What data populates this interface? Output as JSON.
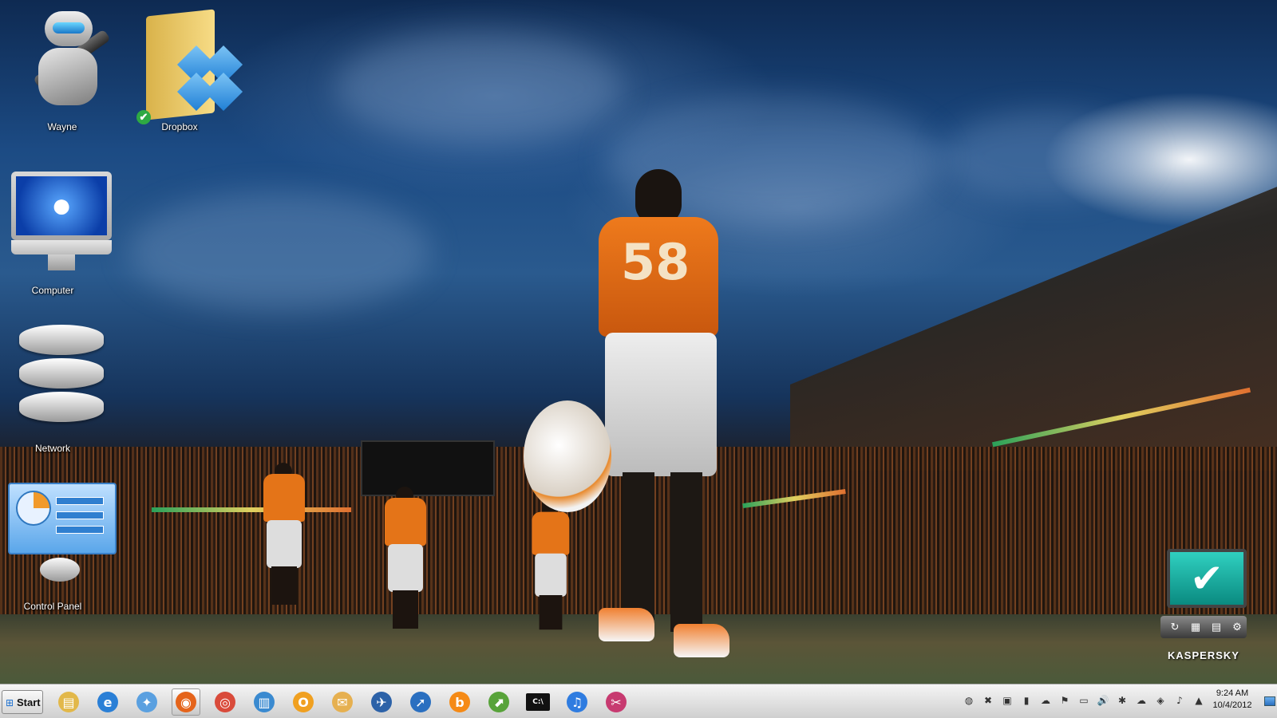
{
  "desktop": {
    "icons": [
      {
        "label": "Wayne",
        "icon": "automator-robot-icon"
      },
      {
        "label": "Dropbox",
        "icon": "dropbox-folder-icon"
      },
      {
        "label": "Computer",
        "icon": "imac-computer-icon"
      },
      {
        "label": "Network",
        "icon": "network-disks-icon"
      },
      {
        "label": "Control Panel",
        "icon": "control-panel-icon"
      }
    ],
    "wallpaper": {
      "jersey_number": "58"
    }
  },
  "kaspersky_gadget": {
    "brand": "KASPERSKY",
    "status_glyph": "✔",
    "buttons": [
      "refresh-icon",
      "calendar-icon",
      "report-icon",
      "settings-icon"
    ]
  },
  "taskbar": {
    "start_label": "Start",
    "pinned": [
      {
        "name": "windows-explorer-icon",
        "glyph": "▤",
        "color": "#e2b84a"
      },
      {
        "name": "internet-explorer-icon",
        "glyph": "e",
        "color": "#2a7fd6"
      },
      {
        "name": "safari-icon",
        "glyph": "✦",
        "color": "#5aa0e0"
      },
      {
        "name": "firefox-icon",
        "glyph": "◉",
        "color": "#e5641b",
        "active": true
      },
      {
        "name": "chrome-icon",
        "glyph": "◎",
        "color": "#d94b3b"
      },
      {
        "name": "notepad-icon",
        "glyph": "▥",
        "color": "#3a8ad0"
      },
      {
        "name": "outlook-icon",
        "glyph": "O",
        "color": "#f0a020"
      },
      {
        "name": "mail-icon",
        "glyph": "✉",
        "color": "#e6b050"
      },
      {
        "name": "thunderbird-icon",
        "glyph": "✈",
        "color": "#2c62a8"
      },
      {
        "name": "rocket-app-icon",
        "glyph": "➚",
        "color": "#2a6fc0"
      },
      {
        "name": "blogger-icon",
        "glyph": "b",
        "color": "#f58a16"
      },
      {
        "name": "stock-chart-icon",
        "glyph": "⬈",
        "color": "#58a33a"
      },
      {
        "name": "command-prompt-icon",
        "glyph": "C:\\",
        "color": "#111111"
      },
      {
        "name": "itunes-icon",
        "glyph": "♫",
        "color": "#2f7ce0"
      },
      {
        "name": "snipping-tool-icon",
        "glyph": "✂",
        "color": "#c73a70"
      }
    ],
    "tray": [
      {
        "name": "network-globe-icon",
        "glyph": "◍"
      },
      {
        "name": "pdf-icon",
        "glyph": "✖"
      },
      {
        "name": "app-window-icon",
        "glyph": "▣"
      },
      {
        "name": "battery-icon",
        "glyph": "▮"
      },
      {
        "name": "cloud-sync-icon",
        "glyph": "☁"
      },
      {
        "name": "action-center-flag-icon",
        "glyph": "⚑"
      },
      {
        "name": "display-icon",
        "glyph": "▭"
      },
      {
        "name": "volume-icon",
        "glyph": "🔊"
      },
      {
        "name": "bluetooth-icon",
        "glyph": "✱"
      },
      {
        "name": "onedrive-icon",
        "glyph": "☁"
      },
      {
        "name": "dropbox-tray-icon",
        "glyph": "◈"
      },
      {
        "name": "sound-icon",
        "glyph": "♪"
      },
      {
        "name": "google-drive-icon",
        "glyph": "▲"
      }
    ],
    "clock_time": "9:24 AM",
    "clock_date": "10/4/2012"
  }
}
